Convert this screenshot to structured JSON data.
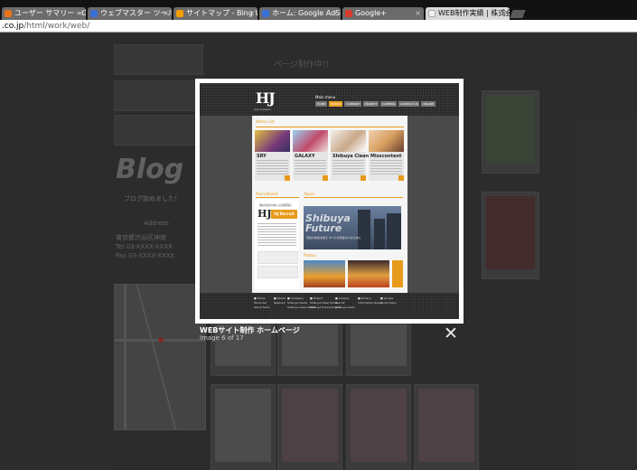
{
  "tabs": [
    {
      "label": "ユーザー サマリー - Goo",
      "favicon_color": "#e8731c",
      "active": false
    },
    {
      "label": "ウェブマスター ツール",
      "favicon_color": "#3a6fd8",
      "active": false
    },
    {
      "label": "サイトマップ - Bing Web",
      "favicon_color": "#f4a000",
      "active": false
    },
    {
      "label": "ホーム: Google AdSense",
      "favicon_color": "#3a6fd8",
      "active": false
    },
    {
      "label": "Google+",
      "favicon_color": "#d33b2c",
      "active": false
    },
    {
      "label": "WEB制作実績 | 株式会",
      "favicon_color": "#f0f0f0",
      "active": true
    }
  ],
  "url": {
    "host": ".co.jp",
    "path": "/html/work/web/"
  },
  "background": {
    "blog_title": "Blog",
    "blog_subtitle": "ブログ始めました！",
    "address_heading": "Address",
    "address_lines": [
      "東京都渋谷区神南",
      "",
      "Tel 03-XXXX-XXXX",
      "Fax 03-XXXX-XXXX"
    ],
    "doodle_text": "ページ制作中!!"
  },
  "lightbox": {
    "preview": {
      "logo": "HJ",
      "logo_sub": "hybrid japan",
      "main_menu": "Main menu",
      "nav": [
        "HOME",
        "WORKS",
        "COMPANY",
        "PROJECT",
        "CAREERS",
        "CONTACT US",
        "ONLINE"
      ],
      "section_label": "Works List",
      "cards": [
        {
          "name": "SRY",
          "color": "#7a3a7a"
        },
        {
          "name": "GALAXY",
          "color": "#c04a6a"
        },
        {
          "name": "Shibuya Clean Smile",
          "color": "#c9a88a"
        },
        {
          "name": "Misscontent",
          "color": "#d8a060"
        }
      ],
      "side_label": "Recruitment",
      "side_tag": "【株式会社HJ新入社員募集】",
      "recruit_badge": "HJ Recruit",
      "topics_label": "Topics",
      "shibuya_title": "Shibuya",
      "shibuya_title2": "Future",
      "shibuya_sub": "渋谷の未来を創る",
      "shibuya_desc": "すべての渋谷の人のために",
      "photos_label": "Photos",
      "footer_cols": [
        [
          "■ Home",
          "Work List",
          "About Team"
        ],
        [
          "■ Works",
          "Network"
        ],
        [
          "■ Company",
          "Shibuya Inside",
          "Shibuya Clean Smile"
        ],
        [
          "■ Project",
          "Shibuya Clean Smile",
          "Shibuya Future Project"
        ],
        [
          "■ Careers",
          "Recruit",
          "Shibuya Clean"
        ],
        [
          "■ Privacy",
          "Information Rules"
        ],
        [
          "■ Access",
          "Ginza Tokyo"
        ]
      ]
    },
    "caption": "WEBサイト制作 ホームページ",
    "counter": "Image 6 of 17",
    "close_glyph": "✕"
  }
}
